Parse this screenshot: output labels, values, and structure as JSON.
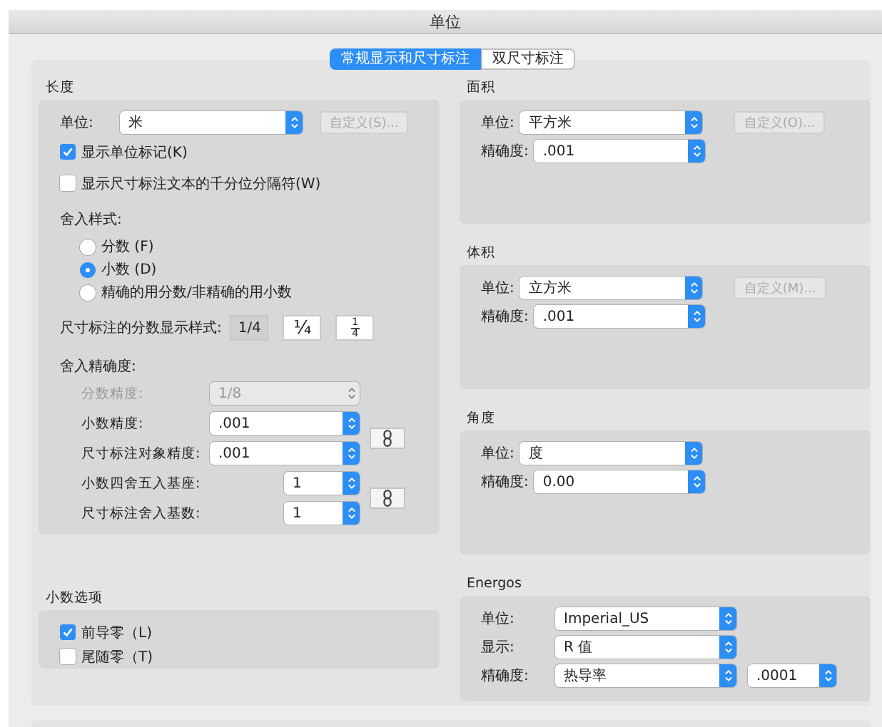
{
  "window": {
    "title": "单位"
  },
  "tabs": [
    {
      "label": "常规显示和尺寸标注",
      "selected": true
    },
    {
      "label": "双尺寸标注",
      "selected": false
    }
  ],
  "length": {
    "title": "长度",
    "unit_label": "单位:",
    "unit": "米",
    "custom_button": {
      "label": "自定义(S)...",
      "disabled": true
    },
    "checkboxes": [
      {
        "label": "显示单位标记(K)",
        "checked": true
      },
      {
        "label": "显示尺寸标注文本的千分位分隔符(W)",
        "checked": false
      }
    ],
    "rounding_title": "舍入样式:",
    "rounding_options": [
      {
        "label": "分数 (F)",
        "selected": false
      },
      {
        "label": "小数 (D)",
        "selected": true
      },
      {
        "label": "精确的用分数/非精确的用小数",
        "selected": false
      }
    ],
    "fraction_style_label": "尺寸标注的分数显示样式:",
    "fraction_styles": [
      {
        "kind": "inline",
        "label": "1/4",
        "selected": true
      },
      {
        "kind": "diagonal",
        "label": "¼",
        "selected": false
      },
      {
        "kind": "stacked",
        "numerator": "1",
        "denominator": "4",
        "selected": false
      }
    ],
    "precision_title": "舍入精确度:",
    "precision_rows": [
      {
        "label": "分数精度:",
        "value": "1/8",
        "disabled": true,
        "kind": "wide"
      },
      {
        "label": "小数精度:",
        "value": ".001",
        "disabled": false,
        "kind": "wide"
      },
      {
        "label": "尺寸标注对象精度:",
        "value": ".001",
        "disabled": false,
        "kind": "wide"
      },
      {
        "label": "小数四舍五入基座:",
        "value": "1",
        "disabled": false,
        "kind": "narrow"
      },
      {
        "label": "尺寸标注舍入基数:",
        "value": "1",
        "disabled": false,
        "kind": "narrow"
      }
    ]
  },
  "decimal_options": {
    "title": "小数选项",
    "checkboxes": [
      {
        "label": "前导零（L)",
        "checked": true
      },
      {
        "label": "尾随零（T)",
        "checked": false
      }
    ]
  },
  "sections": [
    {
      "title": "面积",
      "rows": [
        {
          "label": "单位:",
          "value": "平方米"
        },
        {
          "label": "精确度:",
          "value": ".001"
        }
      ],
      "custom_button": {
        "label": "自定义(O)...",
        "disabled": true
      }
    },
    {
      "title": "体积",
      "rows": [
        {
          "label": "单位:",
          "value": "立方米"
        },
        {
          "label": "精确度:",
          "value": ".001"
        }
      ],
      "custom_button": {
        "label": "自定义(M)...",
        "disabled": true
      }
    },
    {
      "title": "角度",
      "rows": [
        {
          "label": "单位:",
          "value": "度"
        },
        {
          "label": "精确度:",
          "value": "0.00"
        }
      ]
    },
    {
      "title": "Energos",
      "rows": [
        {
          "label": "单位:",
          "value": "Imperial_US"
        },
        {
          "label": "显示:",
          "value": "R 值"
        },
        {
          "label": "精确度:",
          "value": "热导率",
          "extra": ".0001"
        }
      ]
    }
  ]
}
